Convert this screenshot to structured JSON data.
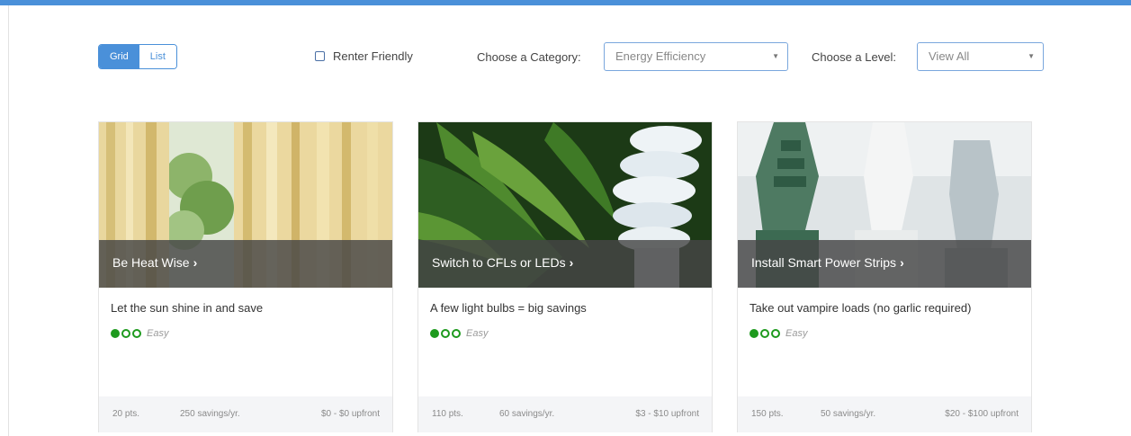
{
  "view_toggle": {
    "grid": "Grid",
    "list": "List",
    "active": "Grid"
  },
  "filters": {
    "renter_label": "Renter Friendly",
    "category_label": "Choose a Category:",
    "category_value": "Energy Efficiency",
    "level_label": "Choose a Level:",
    "level_value": "View All"
  },
  "colors": {
    "accent": "#4a90d9",
    "level_green": "#1e9a1e",
    "footer_bg": "#f4f5f7"
  },
  "cards": [
    {
      "title": "Be Heat Wise",
      "description": "Let the sun shine in and save",
      "level": "Easy",
      "level_filled": 1,
      "points": "20 pts.",
      "savings": "250 savings/yr.",
      "upfront": "$0 - $0 upfront",
      "image": "curtains-window"
    },
    {
      "title": "Switch to CFLs or LEDs",
      "description": "A few light bulbs = big savings",
      "level": "Easy",
      "level_filled": 1,
      "points": "110 pts.",
      "savings": "60 savings/yr.",
      "upfront": "$3 - $10 upfront",
      "image": "cfl-bulb-fern"
    },
    {
      "title": "Install Smart Power Strips",
      "description": "Take out vampire loads (no garlic required)",
      "level": "Easy",
      "level_filled": 1,
      "points": "150 pts.",
      "savings": "50 savings/yr.",
      "upfront": "$20 - $100 upfront",
      "image": "power-plugs"
    }
  ]
}
